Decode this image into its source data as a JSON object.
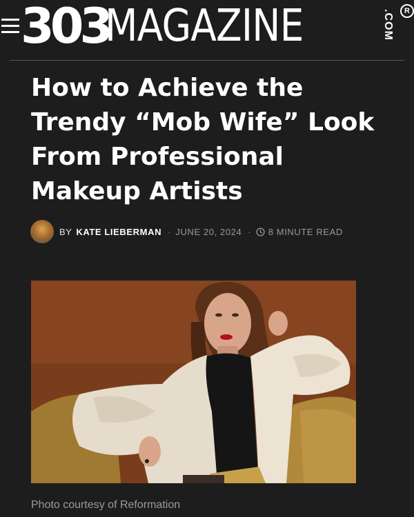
{
  "header": {
    "logo_number": "303",
    "logo_word": "MAGAZINE",
    "logo_domain": ".COM",
    "registered_mark": "R"
  },
  "article": {
    "title": "How to Achieve the Trendy “Mob Wife” Look From Professional Makeup Artists",
    "byline_prefix": "BY",
    "author": "KATE LIEBERMAN",
    "separator": "·",
    "date": "JUNE 20, 2024",
    "read_time": "8 MINUTE READ",
    "image_caption": "Photo courtesy of Reformation"
  },
  "colors": {
    "background": "#1d1d1d",
    "text": "#ffffff",
    "muted_text": "#9a9a9a",
    "divider": "#555555"
  },
  "icons": {
    "menu": "hamburger-icon",
    "clock": "clock-icon"
  }
}
